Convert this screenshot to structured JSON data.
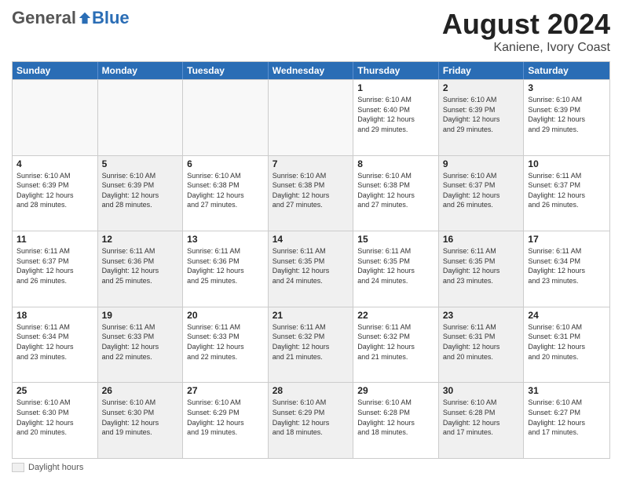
{
  "logo": {
    "general": "General",
    "blue": "Blue"
  },
  "header": {
    "month_year": "August 2024",
    "location": "Kaniene, Ivory Coast"
  },
  "days_of_week": [
    "Sunday",
    "Monday",
    "Tuesday",
    "Wednesday",
    "Thursday",
    "Friday",
    "Saturday"
  ],
  "footer": {
    "label": "Daylight hours"
  },
  "weeks": [
    [
      {
        "day": "",
        "info": "",
        "empty": true
      },
      {
        "day": "",
        "info": "",
        "empty": true
      },
      {
        "day": "",
        "info": "",
        "empty": true
      },
      {
        "day": "",
        "info": "",
        "empty": true
      },
      {
        "day": "1",
        "info": "Sunrise: 6:10 AM\nSunset: 6:40 PM\nDaylight: 12 hours\nand 29 minutes.",
        "shaded": false
      },
      {
        "day": "2",
        "info": "Sunrise: 6:10 AM\nSunset: 6:39 PM\nDaylight: 12 hours\nand 29 minutes.",
        "shaded": true
      },
      {
        "day": "3",
        "info": "Sunrise: 6:10 AM\nSunset: 6:39 PM\nDaylight: 12 hours\nand 29 minutes.",
        "shaded": false
      }
    ],
    [
      {
        "day": "4",
        "info": "Sunrise: 6:10 AM\nSunset: 6:39 PM\nDaylight: 12 hours\nand 28 minutes.",
        "shaded": false
      },
      {
        "day": "5",
        "info": "Sunrise: 6:10 AM\nSunset: 6:39 PM\nDaylight: 12 hours\nand 28 minutes.",
        "shaded": true
      },
      {
        "day": "6",
        "info": "Sunrise: 6:10 AM\nSunset: 6:38 PM\nDaylight: 12 hours\nand 27 minutes.",
        "shaded": false
      },
      {
        "day": "7",
        "info": "Sunrise: 6:10 AM\nSunset: 6:38 PM\nDaylight: 12 hours\nand 27 minutes.",
        "shaded": true
      },
      {
        "day": "8",
        "info": "Sunrise: 6:10 AM\nSunset: 6:38 PM\nDaylight: 12 hours\nand 27 minutes.",
        "shaded": false
      },
      {
        "day": "9",
        "info": "Sunrise: 6:10 AM\nSunset: 6:37 PM\nDaylight: 12 hours\nand 26 minutes.",
        "shaded": true
      },
      {
        "day": "10",
        "info": "Sunrise: 6:11 AM\nSunset: 6:37 PM\nDaylight: 12 hours\nand 26 minutes.",
        "shaded": false
      }
    ],
    [
      {
        "day": "11",
        "info": "Sunrise: 6:11 AM\nSunset: 6:37 PM\nDaylight: 12 hours\nand 26 minutes.",
        "shaded": false
      },
      {
        "day": "12",
        "info": "Sunrise: 6:11 AM\nSunset: 6:36 PM\nDaylight: 12 hours\nand 25 minutes.",
        "shaded": true
      },
      {
        "day": "13",
        "info": "Sunrise: 6:11 AM\nSunset: 6:36 PM\nDaylight: 12 hours\nand 25 minutes.",
        "shaded": false
      },
      {
        "day": "14",
        "info": "Sunrise: 6:11 AM\nSunset: 6:35 PM\nDaylight: 12 hours\nand 24 minutes.",
        "shaded": true
      },
      {
        "day": "15",
        "info": "Sunrise: 6:11 AM\nSunset: 6:35 PM\nDaylight: 12 hours\nand 24 minutes.",
        "shaded": false
      },
      {
        "day": "16",
        "info": "Sunrise: 6:11 AM\nSunset: 6:35 PM\nDaylight: 12 hours\nand 23 minutes.",
        "shaded": true
      },
      {
        "day": "17",
        "info": "Sunrise: 6:11 AM\nSunset: 6:34 PM\nDaylight: 12 hours\nand 23 minutes.",
        "shaded": false
      }
    ],
    [
      {
        "day": "18",
        "info": "Sunrise: 6:11 AM\nSunset: 6:34 PM\nDaylight: 12 hours\nand 23 minutes.",
        "shaded": false
      },
      {
        "day": "19",
        "info": "Sunrise: 6:11 AM\nSunset: 6:33 PM\nDaylight: 12 hours\nand 22 minutes.",
        "shaded": true
      },
      {
        "day": "20",
        "info": "Sunrise: 6:11 AM\nSunset: 6:33 PM\nDaylight: 12 hours\nand 22 minutes.",
        "shaded": false
      },
      {
        "day": "21",
        "info": "Sunrise: 6:11 AM\nSunset: 6:32 PM\nDaylight: 12 hours\nand 21 minutes.",
        "shaded": true
      },
      {
        "day": "22",
        "info": "Sunrise: 6:11 AM\nSunset: 6:32 PM\nDaylight: 12 hours\nand 21 minutes.",
        "shaded": false
      },
      {
        "day": "23",
        "info": "Sunrise: 6:11 AM\nSunset: 6:31 PM\nDaylight: 12 hours\nand 20 minutes.",
        "shaded": true
      },
      {
        "day": "24",
        "info": "Sunrise: 6:10 AM\nSunset: 6:31 PM\nDaylight: 12 hours\nand 20 minutes.",
        "shaded": false
      }
    ],
    [
      {
        "day": "25",
        "info": "Sunrise: 6:10 AM\nSunset: 6:30 PM\nDaylight: 12 hours\nand 20 minutes.",
        "shaded": false
      },
      {
        "day": "26",
        "info": "Sunrise: 6:10 AM\nSunset: 6:30 PM\nDaylight: 12 hours\nand 19 minutes.",
        "shaded": true
      },
      {
        "day": "27",
        "info": "Sunrise: 6:10 AM\nSunset: 6:29 PM\nDaylight: 12 hours\nand 19 minutes.",
        "shaded": false
      },
      {
        "day": "28",
        "info": "Sunrise: 6:10 AM\nSunset: 6:29 PM\nDaylight: 12 hours\nand 18 minutes.",
        "shaded": true
      },
      {
        "day": "29",
        "info": "Sunrise: 6:10 AM\nSunset: 6:28 PM\nDaylight: 12 hours\nand 18 minutes.",
        "shaded": false
      },
      {
        "day": "30",
        "info": "Sunrise: 6:10 AM\nSunset: 6:28 PM\nDaylight: 12 hours\nand 17 minutes.",
        "shaded": true
      },
      {
        "day": "31",
        "info": "Sunrise: 6:10 AM\nSunset: 6:27 PM\nDaylight: 12 hours\nand 17 minutes.",
        "shaded": false
      }
    ]
  ]
}
